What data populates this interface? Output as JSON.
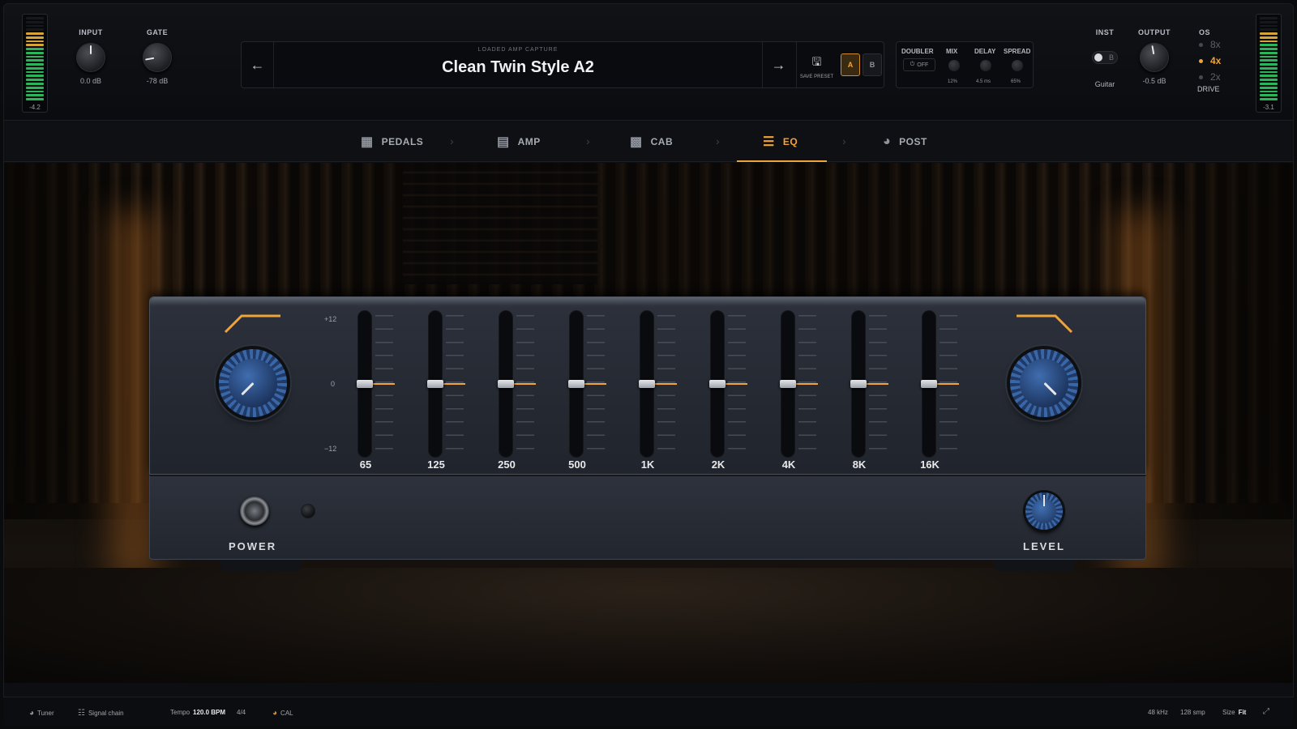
{
  "meters": {
    "input_value": "-4.2",
    "output_value": "-3.1",
    "colors": {
      "green": "#2ab55a",
      "yellow": "#d8a235"
    }
  },
  "input": {
    "label": "INPUT",
    "value": "0.0 dB"
  },
  "gate": {
    "label": "GATE",
    "value": "-78 dB"
  },
  "preset": {
    "subtitle": "LOADED AMP CAPTURE",
    "name": "Clean Twin Style A2",
    "save_label": "SAVE PRESET",
    "slot_a": "A",
    "slot_b": "B"
  },
  "doubler": {
    "title": "DOUBLER",
    "state": "OFF",
    "mix_label": "MIX",
    "mix_value": "12%",
    "delay_label": "DELAY",
    "delay_value": "4.5 ms",
    "spread_label": "SPREAD",
    "spread_value": "65%"
  },
  "inst": {
    "label": "INST",
    "toggle_letter": "B",
    "value": "Guitar"
  },
  "output": {
    "label": "OUTPUT",
    "value": "-0.5 dB"
  },
  "os": {
    "label": "OS",
    "options": [
      "8x",
      "4x",
      "2x"
    ],
    "selected": "4x",
    "drive_label": "DRIVE"
  },
  "tabs": [
    {
      "label": "PEDALS",
      "icon": "pedal-icon"
    },
    {
      "label": "AMP",
      "icon": "amp-icon"
    },
    {
      "label": "CAB",
      "icon": "cab-icon"
    },
    {
      "label": "EQ",
      "icon": "sliders-icon",
      "active": true
    },
    {
      "label": "POST",
      "icon": "gauge-icon"
    }
  ],
  "eq": {
    "scale": {
      "top": "+12",
      "mid": "0",
      "bottom": "−12"
    },
    "bands": [
      {
        "label": "65",
        "gain_db": 0
      },
      {
        "label": "125",
        "gain_db": 0
      },
      {
        "label": "250",
        "gain_db": 0
      },
      {
        "label": "500",
        "gain_db": 0
      },
      {
        "label": "1K",
        "gain_db": 0
      },
      {
        "label": "2K",
        "gain_db": 0
      },
      {
        "label": "4K",
        "gain_db": 0
      },
      {
        "label": "8K",
        "gain_db": 0
      },
      {
        "label": "16K",
        "gain_db": 0
      }
    ],
    "power_label": "POWER",
    "level_label": "LEVEL",
    "accent": "#f0a33a"
  },
  "status": {
    "tuner": "Tuner",
    "signal_chain": "Signal chain",
    "tempo_label": "Tempo",
    "tempo_value": "120.0 BPM",
    "time_sig": "4/4",
    "cal": "CAL",
    "sample_rate": "48 kHz",
    "buffer": "128 smp",
    "size_label": "Size",
    "size_value": "Fit"
  }
}
